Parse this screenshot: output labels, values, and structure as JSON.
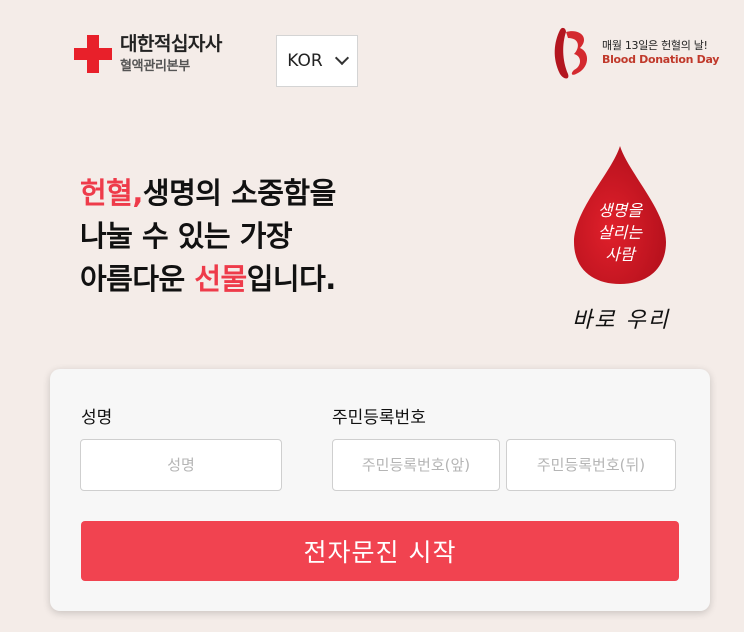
{
  "header": {
    "org_name": "대한적십자사",
    "org_sub": "혈액관리본부",
    "language": "KOR",
    "campaign_line1": "매월 13일은 헌혈의 날!",
    "campaign_line2": "Blood Donation Day"
  },
  "hero": {
    "line1_accent": "헌혈,",
    "line1_rest": "생명의 소중함을",
    "line2": "나눌 수 있는 가장",
    "line3_pre": "아름다운 ",
    "line3_accent": "선물",
    "line3_post": "입니다.",
    "drop_line1": "생명을",
    "drop_line2": "살리는",
    "drop_line3": "사람",
    "slogan": "바로 우리"
  },
  "form": {
    "name_label": "성명",
    "name_placeholder": "성명",
    "rrn_label": "주민등록번호",
    "rrn_front_placeholder": "주민등록번호(앞)",
    "rrn_back_placeholder": "주민등록번호(뒤)",
    "submit_label": "전자문진 시작"
  },
  "colors": {
    "background": "#f4ece8",
    "accent": "#ee3b4a",
    "button": "#f14350",
    "logo_red": "#e8202a"
  }
}
